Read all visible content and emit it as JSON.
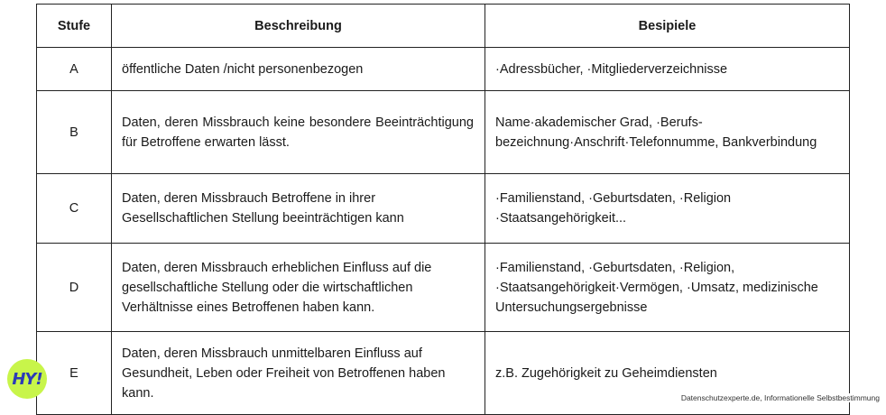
{
  "table": {
    "headers": [
      "Stufe",
      "Beschreibung",
      "Besipiele"
    ],
    "rows": [
      {
        "stufe": "A",
        "beschreibung": "öffentliche Daten /nicht personenbezogen",
        "beispiele": "·Adressbücher, ·Mitgliederverzeichnisse"
      },
      {
        "stufe": "B",
        "beschreibung": "Daten, deren Missbrauch keine besondere Beeinträchtigung für Betroffene erwarten lässt.",
        "beispiele": "Name·akademischer Grad, ·Berufs-bezeichnung·Anschrift·Telefonnumme, Bankverbindung"
      },
      {
        "stufe": "C",
        "beschreibung": "Daten, deren Missbrauch Betroffene in ihrer Gesellschaftlichen Stellung beeinträchtigen kann",
        "beispiele": "·Familienstand, ·Geburtsdaten, ·Religion ·Staatsangehörigkeit..."
      },
      {
        "stufe": "D",
        "beschreibung": "Daten, deren Missbrauch erheblichen Einfluss auf die gesellschaftliche Stellung oder die wirtschaftlichen Verhältnisse eines Betroffenen haben kann.",
        "beispiele": "·Familienstand, ·Geburtsdaten, ·Religion, ·Staatsangehörigkeit·Vermögen, ·Umsatz, medizinische Untersuchungsergebnisse"
      },
      {
        "stufe": "E",
        "beschreibung": "Daten, deren Missbrauch unmittelbaren Einfluss auf Gesundheit, Leben oder Freiheit von Betroffenen haben kann.",
        "beispiele": "z.B. Zugehörigkeit zu Geheimdiensten"
      }
    ]
  },
  "logo": {
    "text": "HY!",
    "bg_color": "#c8f54a",
    "text_color": "#2b3bb8"
  },
  "source": "Datenschutzexperte.de, Informationelle Selbstbestimmung"
}
